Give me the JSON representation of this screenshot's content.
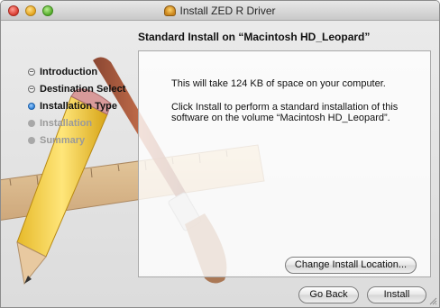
{
  "window": {
    "title": "Install ZED R Driver"
  },
  "heading": "Standard Install on “Macintosh HD_Leopard”",
  "steps": [
    {
      "label": "Introduction",
      "state": "done"
    },
    {
      "label": "Destination Select",
      "state": "done"
    },
    {
      "label": "Installation Type",
      "state": "current"
    },
    {
      "label": "Installation",
      "state": "future"
    },
    {
      "label": "Summary",
      "state": "future"
    }
  ],
  "content": {
    "space_text": "This will take 124 KB of space on your computer.",
    "install_text": "Click Install to perform a standard installation of this software on the volume “Macintosh HD_Leopard”."
  },
  "buttons": {
    "change_location": "Change Install Location...",
    "go_back": "Go Back",
    "install": "Install"
  },
  "colors": {
    "current_step": "#2f7fd7",
    "window_bg": "#e3e3e3"
  },
  "icons": [
    "close-icon",
    "minimize-icon",
    "zoom-icon",
    "installer-package-icon",
    "resize-grip-icon"
  ]
}
